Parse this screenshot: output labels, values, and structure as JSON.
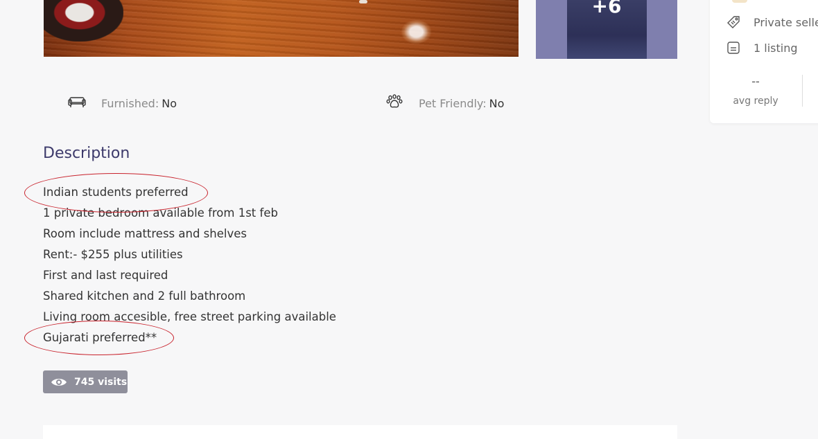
{
  "gallery": {
    "more_photos_label": "+6"
  },
  "features": [
    {
      "icon": "sofa-icon",
      "label": "Furnished:",
      "value": "No"
    },
    {
      "icon": "paw-icon",
      "label": "Pet Friendly:",
      "value": "No"
    }
  ],
  "description": {
    "title": "Description",
    "lines": [
      "Indian students preferred",
      "1 private bedroom available from 1st feb",
      "Room include mattress and shelves",
      "Rent:- $255 plus utilities",
      "First and last required",
      "Shared kitchen and 2 full bathroom",
      "Living room accesible, free street parking available",
      "Gujarati preferred**"
    ]
  },
  "visits": {
    "icon": "eye-icon",
    "label": "745 visits"
  },
  "seller": {
    "type_icon": "tag-icon",
    "type_label": "Private seller",
    "listings_icon": "listing-icon",
    "listings_label": "1 listing",
    "avg_reply_value": "--",
    "avg_reply_label": "avg reply"
  },
  "colors": {
    "annotation": "#c8212b",
    "heading": "#3d3a6b",
    "visits_badge": "#8f8f9b",
    "thumb_overlay": "#7f7fae"
  }
}
